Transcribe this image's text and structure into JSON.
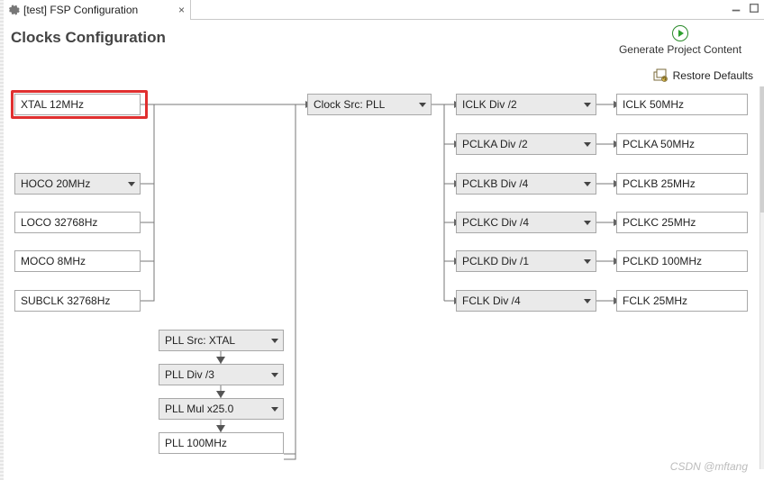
{
  "tab": {
    "title": "[test] FSP Configuration"
  },
  "page": {
    "title": "Clocks Configuration"
  },
  "actions": {
    "generate": "Generate Project Content",
    "restore": "Restore Defaults"
  },
  "sources": {
    "xtal": "XTAL 12MHz",
    "hoco": "HOCO 20MHz",
    "loco": "LOCO 32768Hz",
    "moco": "MOCO 8MHz",
    "subclk": "SUBCLK 32768Hz"
  },
  "pll": {
    "src": "PLL Src: XTAL",
    "div": "PLL Div /3",
    "mul": "PLL Mul x25.0",
    "out": "PLL 100MHz"
  },
  "clock_src": "Clock Src: PLL",
  "dividers": {
    "iclk": {
      "div": "ICLK Div /2",
      "out": "ICLK 50MHz"
    },
    "pclka": {
      "div": "PCLKA Div /2",
      "out": "PCLKA 50MHz"
    },
    "pclkb": {
      "div": "PCLKB Div /4",
      "out": "PCLKB 25MHz"
    },
    "pclkc": {
      "div": "PCLKC Div /4",
      "out": "PCLKC 25MHz"
    },
    "pclkd": {
      "div": "PCLKD Div /1",
      "out": "PCLKD 100MHz"
    },
    "fclk": {
      "div": "FCLK Div /4",
      "out": "FCLK 25MHz"
    }
  },
  "watermark": "CSDN @mftang"
}
